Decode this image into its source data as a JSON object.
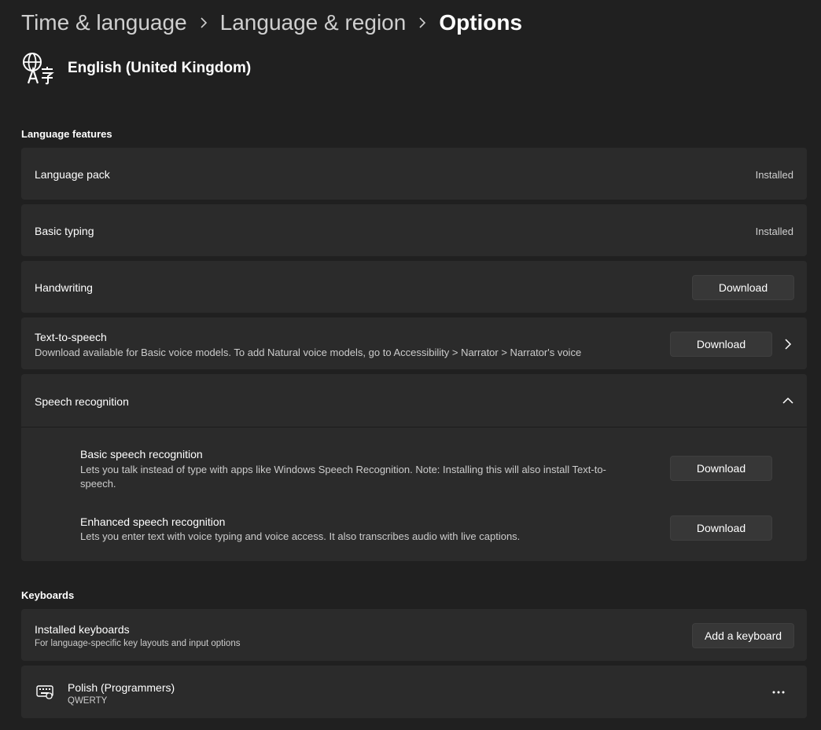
{
  "breadcrumb": {
    "items": [
      "Time & language",
      "Language & region",
      "Options"
    ]
  },
  "language": {
    "name": "English (United Kingdom)",
    "icon": "language-globe-icon"
  },
  "language_features": {
    "title": "Language features",
    "language_pack": {
      "label": "Language pack",
      "status": "Installed"
    },
    "basic_typing": {
      "label": "Basic typing",
      "status": "Installed"
    },
    "handwriting": {
      "label": "Handwriting",
      "button": "Download"
    },
    "text_to_speech": {
      "label": "Text-to-speech",
      "description": "Download available for Basic voice models. To add Natural voice models, go to Accessibility > Narrator > Narrator's voice",
      "button": "Download"
    },
    "speech_recognition": {
      "label": "Speech recognition",
      "expanded": true,
      "basic": {
        "label": "Basic speech recognition",
        "description_line1": "Lets you talk instead of type with apps like Windows Speech Recognition. Note: Installing this will also install Text-to-",
        "description_line2": "speech.",
        "button": "Download"
      },
      "enhanced": {
        "label": "Enhanced speech recognition",
        "description": "Lets you enter text with voice typing and voice access. It also transcribes audio with live captions.",
        "button": "Download"
      }
    }
  },
  "keyboards": {
    "title": "Keyboards",
    "installed": {
      "label": "Installed keyboards",
      "description": "For language-specific key layouts and input options",
      "button": "Add a keyboard"
    },
    "items": [
      {
        "name": "Polish (Programmers)",
        "layout": "QWERTY",
        "icon": "keyboard-icon"
      }
    ]
  },
  "colors": {
    "background": "#202020",
    "card": "#2b2b2b",
    "button": "#373737",
    "text_secondary": "#cccccc"
  }
}
